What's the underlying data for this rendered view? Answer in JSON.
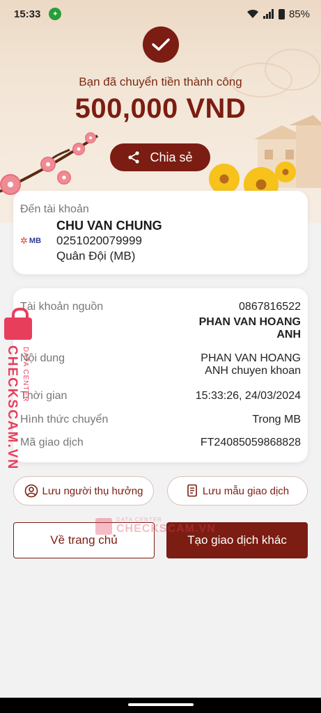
{
  "status_bar": {
    "time": "15:33",
    "battery": "85%"
  },
  "result": {
    "message": "Bạn đã chuyển tiền thành công",
    "amount": "500,000 VND",
    "share_label": "Chia sẻ"
  },
  "destination": {
    "label": "Đến tài khoản",
    "bank_logo_text": "MB",
    "name": "CHU VAN CHUNG",
    "account": "0251020079999",
    "bank": "Quân Đội (MB)"
  },
  "details": {
    "source_label": "Tài khoản nguồn",
    "source_account": "0867816522",
    "source_name": "PHAN VAN HOANG ANH",
    "content_label": "Nội dung",
    "content_value": "PHAN VAN HOANG ANH chuyen khoan",
    "time_label": "Thời gian",
    "time_value": "15:33:26, 24/03/2024",
    "method_label": "Hình thức chuyển",
    "method_value": "Trong MB",
    "tx_label": "Mã giao dịch",
    "tx_value": "FT24085059868828"
  },
  "actions": {
    "save_beneficiary": "Lưu người thụ hưởng",
    "save_template": "Lưu mẫu giao dịch",
    "home": "Về trang chủ",
    "new_transaction": "Tạo giao dịch khác"
  },
  "watermark": {
    "brand": "CHECKSCAM.VN",
    "sub": "DATA CENTER"
  },
  "colors": {
    "primary": "#7b1d12",
    "watermark": "#e73e5c"
  }
}
